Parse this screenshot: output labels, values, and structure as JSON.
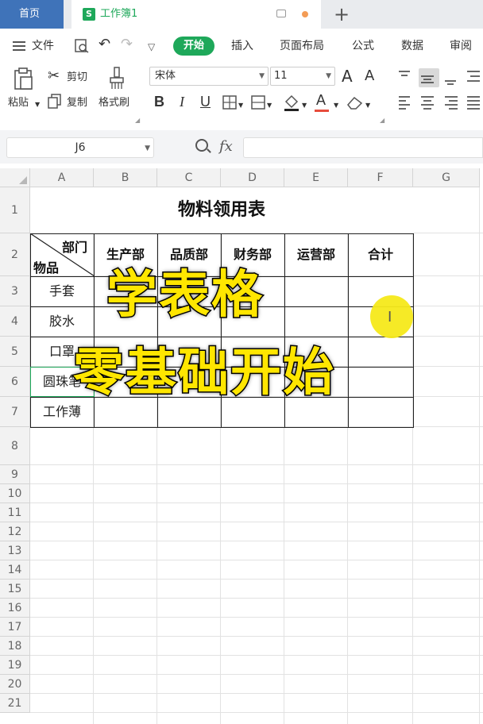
{
  "tabs": {
    "home": "首页",
    "workbook_icon": "S",
    "workbook": "工作簿1"
  },
  "menu": {
    "file": "文件",
    "items": [
      "开始",
      "插入",
      "页面布局",
      "公式",
      "数据",
      "审阅"
    ]
  },
  "ribbon": {
    "paste": "粘贴",
    "cut": "剪切",
    "copy": "复制",
    "format_painter": "格式刷",
    "font_name": "宋体",
    "font_size": "11",
    "bold": "B",
    "italic": "I",
    "underline": "U",
    "font_grow": "A",
    "font_shrink": "A",
    "font_color": "A"
  },
  "formula_bar": {
    "cell_ref": "J6",
    "fx": "fx",
    "value": ""
  },
  "sheet": {
    "columns": [
      "A",
      "B",
      "C",
      "D",
      "E",
      "F",
      "G"
    ],
    "rows": [
      "1",
      "2",
      "3",
      "4",
      "5",
      "6",
      "7",
      "8",
      "9",
      "10",
      "11",
      "12",
      "13",
      "14",
      "15",
      "16",
      "17",
      "18",
      "19",
      "20",
      "21"
    ],
    "title": "物料领用表",
    "diag_top": "部门",
    "diag_bottom": "物品",
    "headers": [
      "生产部",
      "品质部",
      "财务部",
      "运营部",
      "合计"
    ],
    "items": [
      "手套",
      "胶水",
      "口罩",
      "圆珠笔",
      "工作薄"
    ]
  },
  "overlay": {
    "line1": "学表格",
    "line2": "零基础开始"
  },
  "colors": {
    "accent_green": "#1ea85a",
    "home_tab_blue": "#3f73b9",
    "overlay_yellow": "#ffe600",
    "cursor_highlight": "#f5e91a"
  }
}
